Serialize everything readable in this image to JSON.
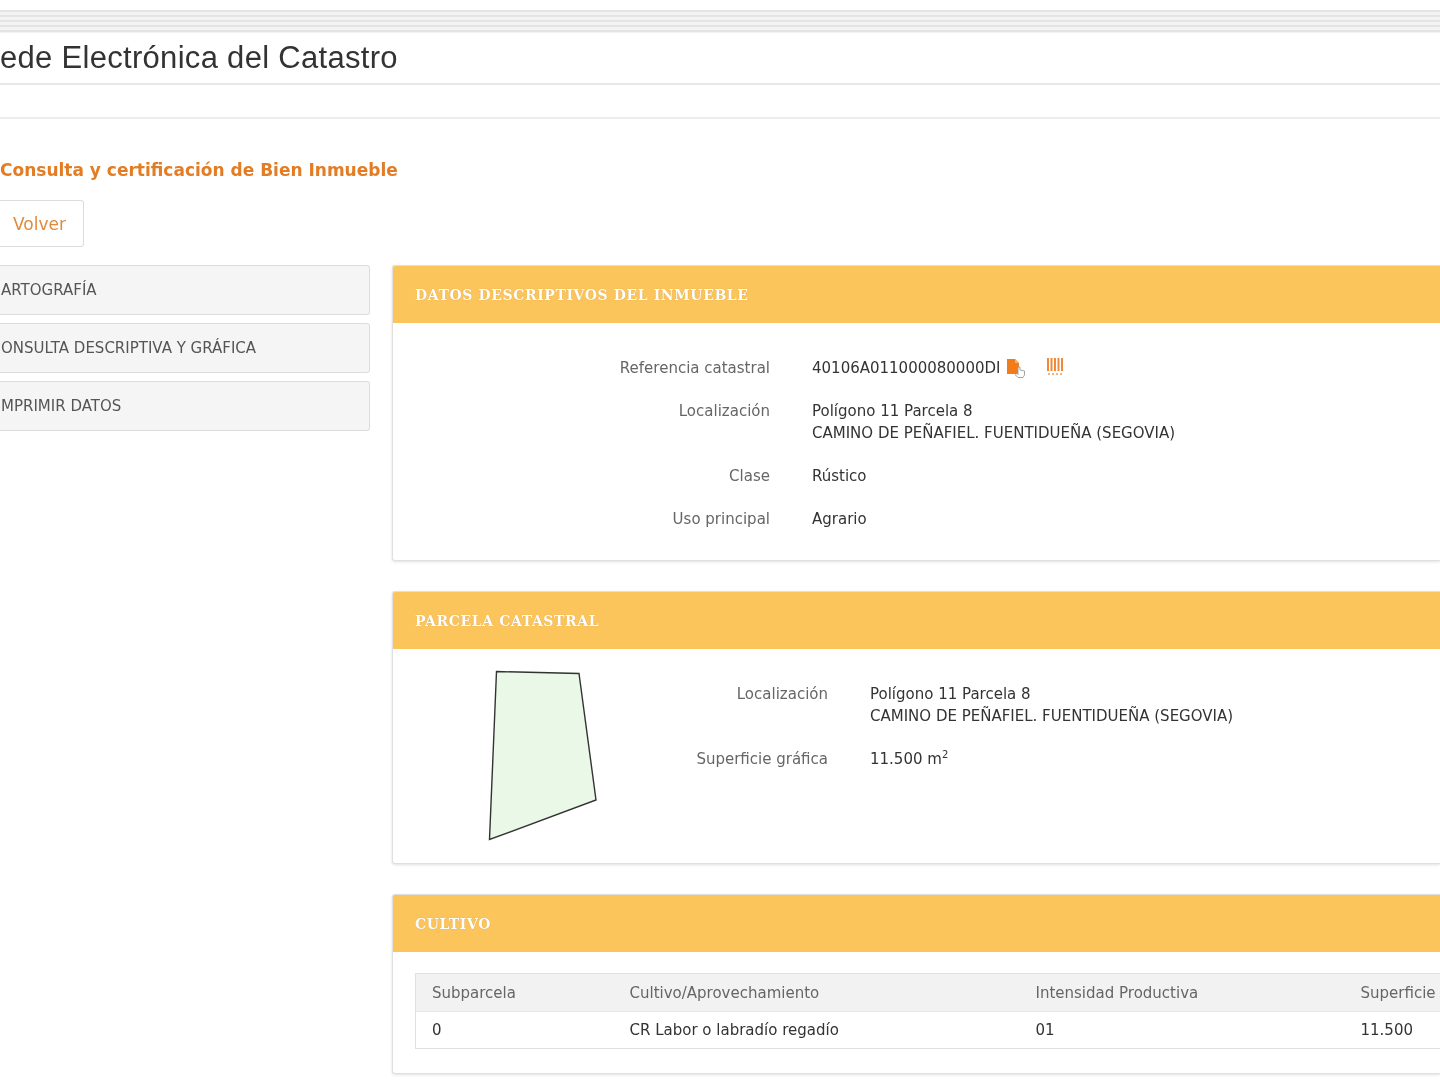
{
  "header": {
    "title": "ede Electrónica del Catastro"
  },
  "page_title": "Consulta y certificación de Bien Inmueble",
  "back_button": {
    "label": "Volver"
  },
  "side_menu": {
    "items": [
      {
        "label": "ARTOGRAFÍA"
      },
      {
        "label": "ONSULTA DESCRIPTIVA Y GRÁFICA"
      },
      {
        "label": "MPRIMIR DATOS"
      }
    ]
  },
  "sections": [
    {
      "kind": "fields",
      "title": "DATOS DESCRIPTIVOS DEL INMUEBLE",
      "fields": [
        {
          "kind": "reference",
          "label": "Referencia catastral",
          "lines": [
            "40106A011000080000DI"
          ]
        },
        {
          "kind": "text",
          "label": "Localización",
          "lines": [
            "Polígono 11 Parcela 8",
            "CAMINO DE PEÑAFIEL. FUENTIDUEÑA (SEGOVIA)"
          ]
        },
        {
          "kind": "text",
          "label": "Clase",
          "lines": [
            "Rústico"
          ]
        },
        {
          "kind": "text",
          "label": "Uso principal",
          "lines": [
            "Agrario"
          ]
        }
      ]
    },
    {
      "kind": "parcel",
      "title": "PARCELA CATASTRAL",
      "fields": [
        {
          "kind": "text",
          "label": "Localización",
          "lines": [
            "Polígono 11 Parcela 8",
            "CAMINO DE PEÑAFIEL. FUENTIDUEÑA (SEGOVIA)"
          ]
        },
        {
          "kind": "text",
          "label": "Superficie gráfica",
          "lines": [
            "11.500 m$^{2}$"
          ]
        }
      ]
    },
    {
      "kind": "table",
      "title": "CULTIVO",
      "table": {
        "columns": [
          "Subparcela",
          "Cultivo/Aprovechamiento",
          "Intensidad Productiva",
          "Superficie"
        ],
        "rows": [
          [
            "0",
            "CR Labor o labradío regadío",
            "01",
            "11.500"
          ]
        ]
      }
    }
  ]
}
